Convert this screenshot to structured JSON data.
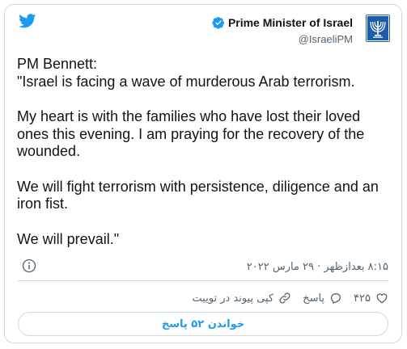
{
  "brand": {
    "icon": "twitter-bird-icon",
    "color": "#1d9bf0"
  },
  "author": {
    "name": "Prime Minister of Israel",
    "handle": "@IsraeliPM",
    "verified_icon": "verified-badge-icon",
    "avatar_icon": "menorah-emblem-icon",
    "avatar_color": "#1c5ca8"
  },
  "tweet": {
    "lines": [
      "PM Bennett:",
      "\"Israel is facing a wave of murderous Arab terrorism.",
      "My heart is with the families who have lost their loved ones this evening. I am praying for the recovery of the wounded.",
      "We will fight terrorism with persistence, diligence and an iron fist.",
      "We will prevail.\""
    ]
  },
  "meta": {
    "timestamp": "۸:۱۵ بعدازظهر · ۲۹ مارس ۲۰۲۲",
    "info_icon": "info-icon"
  },
  "actions": {
    "like_icon": "heart-icon",
    "like_count": "۴۲۵",
    "reply_icon": "reply-bubble-icon",
    "reply_label": "پاسخ",
    "copy_icon": "link-icon",
    "copy_label": "کپی پیوند در توییت"
  },
  "read_replies": {
    "label": "خواندن ۵۲ پاسخ"
  },
  "colors": {
    "accent": "#1d9bf0",
    "muted": "#536471",
    "border": "#cfd9de",
    "text": "#0f1419"
  }
}
